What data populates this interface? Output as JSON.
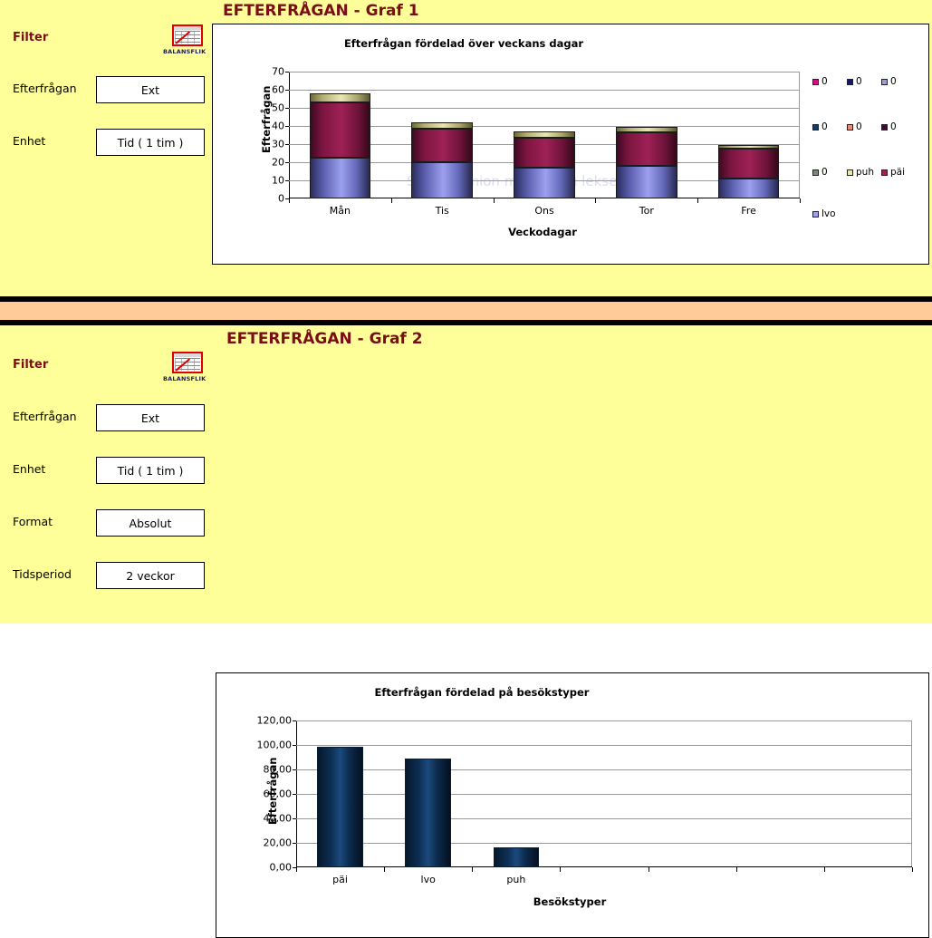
{
  "panels": [
    {
      "id": "graf1",
      "title": "EFTERFRÅGAN - Graf 1",
      "sidebar": {
        "filter_label": "Filter",
        "tab_icon_label": "BALANSFLIK",
        "fields": [
          {
            "label": "Efterfrågan",
            "value": "Ext"
          },
          {
            "label": "Enhet",
            "value": "Tid ( 1 tim )"
          }
        ]
      },
      "chart_data": {
        "type": "bar",
        "stacked": true,
        "title": "Efterfrågan fördelad över veckans dagar",
        "xlabel": "Veckodagar",
        "ylabel": "Efterfrågan",
        "categories": [
          "Mån",
          "Tis",
          "Ons",
          "Tor",
          "Fre"
        ],
        "ylim": [
          0,
          70
        ],
        "yticks": [
          0,
          10,
          20,
          30,
          40,
          50,
          60,
          70
        ],
        "ytick_labels": [
          "0",
          "10",
          "20",
          "30",
          "40",
          "50",
          "60",
          "70"
        ],
        "grid": true,
        "legend_position": "right",
        "series": [
          {
            "name": "lvo",
            "color": "#9ca0ef",
            "values": [
              22.5,
              19.8,
              17.2,
              17.8,
              11.0
            ]
          },
          {
            "name": "päi",
            "color": "#9e2156",
            "values": [
              30.5,
              18.7,
              16.3,
              18.6,
              16.5
            ]
          },
          {
            "name": "puh",
            "color": "#eae6b4",
            "values": [
              5.0,
              3.3,
              3.4,
              3.0,
              1.9
            ]
          }
        ],
        "totals": [
          58.0,
          41.8,
          36.9,
          39.4,
          29.4
        ],
        "watermark": "Suorakulmion muotoinen lekse"
      },
      "legend": {
        "rows": [
          [
            {
              "label": "0",
              "color": "#c71585"
            },
            {
              "label": "0",
              "color": "#141a5e"
            },
            {
              "label": "0",
              "color": "#9aa0c8"
            }
          ],
          [
            {
              "label": "0",
              "color": "#163a66"
            },
            {
              "label": "0",
              "color": "#e98a7a"
            },
            {
              "label": "0",
              "color": "#3d0a30"
            }
          ],
          [
            {
              "label": "0",
              "color": "#7d8a7a"
            },
            {
              "label": "puh",
              "color": "#eae6b4"
            },
            {
              "label": "päi",
              "color": "#9e2156"
            }
          ],
          [
            {
              "label": "lvo",
              "color": "#9ca0ef"
            }
          ]
        ]
      }
    },
    {
      "id": "graf2",
      "title": "EFTERFRÅGAN - Graf 2",
      "sidebar": {
        "filter_label": "Filter",
        "tab_icon_label": "BALANSFLIK",
        "fields": [
          {
            "label": "Efterfrågan",
            "value": "Ext"
          },
          {
            "label": "Enhet",
            "value": "Tid ( 1 tim )"
          },
          {
            "label": "Format",
            "value": "Absolut"
          },
          {
            "label": "Tidsperiod",
            "value": "2 veckor"
          }
        ]
      },
      "chart_data": {
        "type": "bar",
        "stacked": false,
        "title": "Efterfrågan fördelad på besökstyper",
        "xlabel": "Besökstyper",
        "ylabel": "Efterfrågan",
        "categories": [
          "päi",
          "lvo",
          "puh",
          "",
          "",
          "",
          ""
        ],
        "values": [
          98.5,
          89.0,
          16.5,
          0,
          0,
          0,
          0
        ],
        "ylim": [
          0,
          120
        ],
        "yticks": [
          0,
          20,
          40,
          60,
          80,
          100,
          120
        ],
        "ytick_labels": [
          "0,00",
          "20,00",
          "40,00",
          "60,00",
          "80,00",
          "100,00",
          "120,00"
        ],
        "grid": true,
        "legend_position": "none",
        "bar_color": "#0d2f55"
      }
    }
  ],
  "colors": {
    "panel_background": "#ffff99",
    "divider": "#ffcc99",
    "title_text": "#7b0d17",
    "card_background": "#ffffff",
    "border": "#000000"
  }
}
